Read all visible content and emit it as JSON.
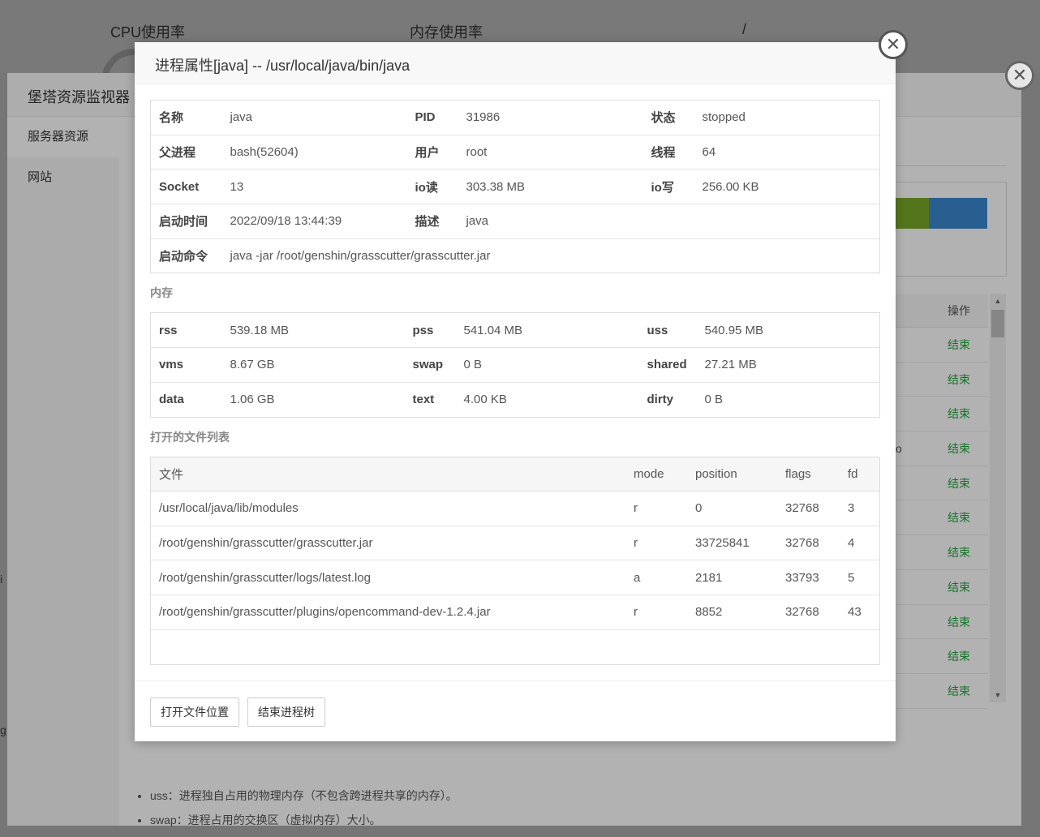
{
  "background": {
    "top_labels": [
      "CPU使用率",
      "内存使用率",
      "/"
    ],
    "side_text_1": "i",
    "side_text_2": "g",
    "partial_cell": "o"
  },
  "monitor_window": {
    "title": "堡塔资源监视器",
    "sidebar": [
      {
        "label": "服务器资源"
      },
      {
        "label": "网站"
      }
    ],
    "table_header_action": "操作",
    "row_action_label": "结束",
    "row_count": 11,
    "notes": [
      "uss：进程独自占用的物理内存（不包含跨进程共享的内存）。",
      "swap：进程占用的交换区（虚拟内存）大小。"
    ],
    "colors": {
      "green": "#7aa82a",
      "blue": "#3b87cf",
      "action": "#20a53a"
    }
  },
  "modal": {
    "title": "进程属性[java] -- /usr/local/java/bin/java",
    "info": {
      "name_label": "名称",
      "name": "java",
      "pid_label": "PID",
      "pid": "31986",
      "status_label": "状态",
      "status": "stopped",
      "parent_label": "父进程",
      "parent": "bash(52604)",
      "user_label": "用户",
      "user": "root",
      "threads_label": "线程",
      "threads": "64",
      "socket_label": "Socket",
      "socket": "13",
      "io_read_label": "io读",
      "io_read": "303.38 MB",
      "io_write_label": "io写",
      "io_write": "256.00 KB",
      "start_time_label": "启动时间",
      "start_time": "2022/09/18 13:44:39",
      "desc_label": "描述",
      "desc": "java",
      "cmd_label": "启动命令",
      "cmd": "java -jar /root/genshin/grasscutter/grasscutter.jar"
    },
    "memory_section": "内存",
    "memory": {
      "rss_label": "rss",
      "rss": "539.18 MB",
      "pss_label": "pss",
      "pss": "541.04 MB",
      "uss_label": "uss",
      "uss": "540.95 MB",
      "vms_label": "vms",
      "vms": "8.67 GB",
      "swap_label": "swap",
      "swap": "0 B",
      "shared_label": "shared",
      "shared": "27.21 MB",
      "data_label": "data",
      "data": "1.06 GB",
      "text_label": "text",
      "text": "4.00 KB",
      "dirty_label": "dirty",
      "dirty": "0 B"
    },
    "files_section": "打开的文件列表",
    "files_columns": [
      "文件",
      "mode",
      "position",
      "flags",
      "fd"
    ],
    "files": [
      {
        "file": "/usr/local/java/lib/modules",
        "mode": "r",
        "position": "0",
        "flags": "32768",
        "fd": "3"
      },
      {
        "file": "/root/genshin/grasscutter/grasscutter.jar",
        "mode": "r",
        "position": "33725841",
        "flags": "32768",
        "fd": "4"
      },
      {
        "file": "/root/genshin/grasscutter/logs/latest.log",
        "mode": "a",
        "position": "2181",
        "flags": "33793",
        "fd": "5"
      },
      {
        "file": "/root/genshin/grasscutter/plugins/opencommand-dev-1.2.4.jar",
        "mode": "r",
        "position": "8852",
        "flags": "32768",
        "fd": "43"
      }
    ],
    "buttons": {
      "open_location": "打开文件位置",
      "kill_tree": "结束进程树"
    },
    "close_glyph": "✕"
  }
}
